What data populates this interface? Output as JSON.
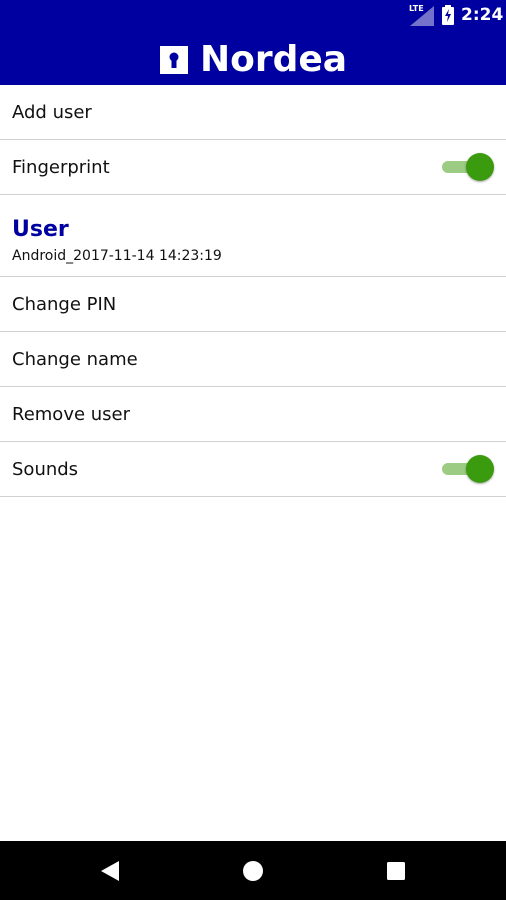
{
  "status_bar": {
    "network": "LTE",
    "time": "2:24"
  },
  "header": {
    "brand": "Nordea",
    "background_color": "#0000a0"
  },
  "settings": {
    "add_user": "Add user",
    "fingerprint": {
      "label": "Fingerprint",
      "enabled": true
    },
    "user_section": {
      "title": "User",
      "subtitle": "Android_2017-11-14 14:23:19"
    },
    "change_pin": "Change PIN",
    "change_name": "Change name",
    "remove_user": "Remove user",
    "sounds": {
      "label": "Sounds",
      "enabled": true
    }
  },
  "colors": {
    "accent": "#0000a0",
    "toggle_on_thumb": "#3a9b0e",
    "toggle_on_track": "#9ccc83"
  },
  "icons": {
    "logo": "keyhole-logo-icon",
    "signal": "signal-icon",
    "battery": "battery-charging-icon",
    "back": "back-triangle-icon",
    "home": "home-circle-icon",
    "recents": "recents-square-icon"
  }
}
